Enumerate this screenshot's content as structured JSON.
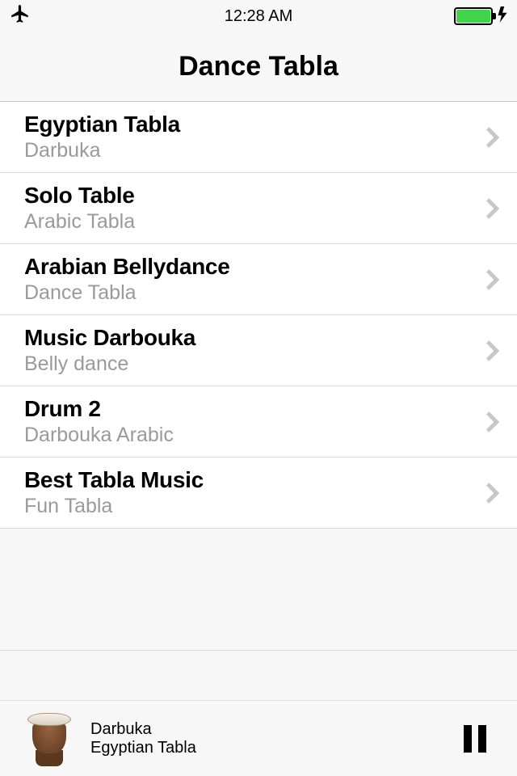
{
  "status": {
    "time": "12:28 AM"
  },
  "nav": {
    "title": "Dance Tabla"
  },
  "list": {
    "items": [
      {
        "title": "Egyptian Tabla",
        "subtitle": "Darbuka"
      },
      {
        "title": "Solo Table",
        "subtitle": "Arabic Tabla"
      },
      {
        "title": "Arabian Bellydance",
        "subtitle": "Dance Tabla"
      },
      {
        "title": "Music Darbouka",
        "subtitle": "Belly dance"
      },
      {
        "title": "Drum 2",
        "subtitle": "Darbouka Arabic"
      },
      {
        "title": "Best Tabla Music",
        "subtitle": "Fun Tabla"
      }
    ]
  },
  "nowPlaying": {
    "line1": "Darbuka",
    "line2": "Egyptian Tabla"
  }
}
